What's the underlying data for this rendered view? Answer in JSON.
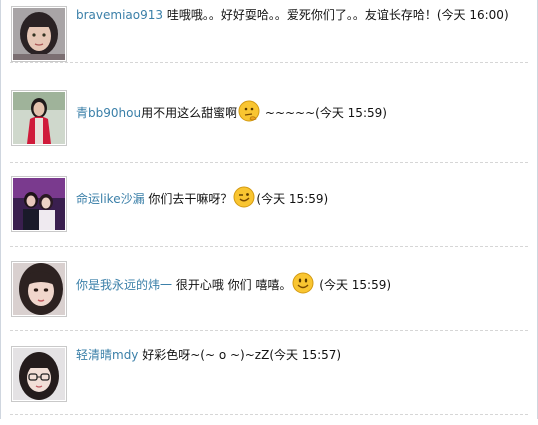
{
  "comments": [
    {
      "user": "bravemiao913",
      "message": "哇哦哦。。好好耍哈。。爱死你们了。。友谊长存哈！",
      "time": "(今天 16:00)",
      "avatar": "avatar-woman-bob-hair",
      "emoji": ""
    },
    {
      "user": "青bb90hou",
      "message": "用不用这么甜蜜啊",
      "after_emoji": " ~~~~~",
      "time": "(今天 15:59)",
      "avatar": "avatar-woman-red-coat",
      "emoji": "thinking-face-icon"
    },
    {
      "user": "命运like沙漏",
      "message": "  你们去干嘛呀？",
      "time": "(今天 15:59)",
      "avatar": "avatar-couple-stage",
      "emoji": "winking-face-icon"
    },
    {
      "user": "你是我永远的炜一",
      "message": "  很开心哦  你们  嘻嘻。",
      "time": "  (今天 15:59)",
      "avatar": "avatar-girl-closeup",
      "emoji": "smiling-face-icon"
    },
    {
      "user": "轻清晴mdy",
      "message": " 好彩色呀~(~  o ~)~zZ",
      "time": "(今天 15:57)",
      "avatar": "avatar-girl-glasses",
      "emoji": ""
    }
  ]
}
